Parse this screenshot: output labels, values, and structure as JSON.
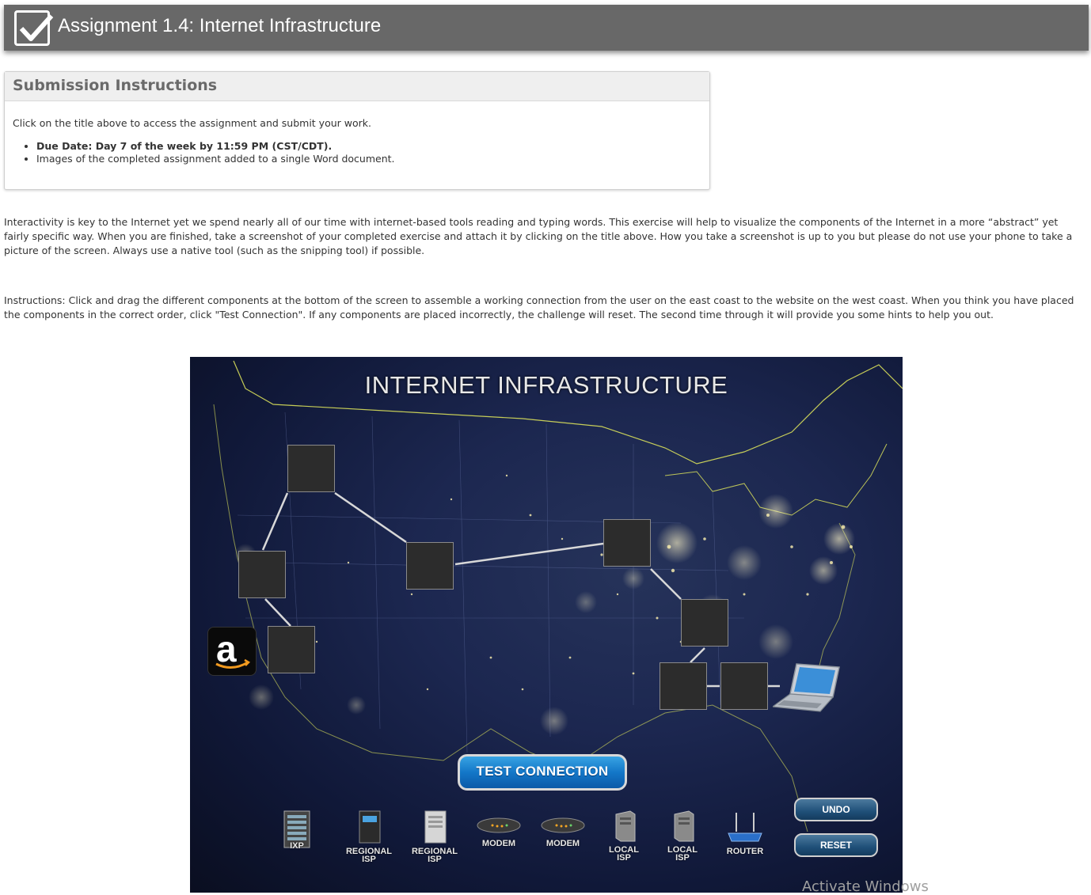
{
  "header": {
    "title": "Assignment 1.4: Internet Infrastructure"
  },
  "submission": {
    "heading": "Submission Instructions",
    "intro": "Click on the title above to access the assignment and submit your work.",
    "items": [
      "Due Date: Day 7 of the week by 11:59 PM (CST/CDT).",
      "Images of the completed assignment added to a single Word document."
    ]
  },
  "paragraphs": {
    "intro": "Interactivity is key to the Internet yet we spend nearly all of our time with internet-based tools reading and typing words. This exercise will help to visualize the components of the Internet in a more “abstract” yet fairly specific way. When you are finished, take a screenshot of your completed exercise and attach it by clicking on the title above. How you take a screenshot is up to you but please do not use your phone to take a picture of the screen. Always use a native tool (such as the snipping tool) if possible.",
    "instructions": "Instructions:  Click and drag the different components at the bottom of the screen to assemble a working connection from the user on the east coast to the website on the west coast.  When you think you have placed the components in the correct order, click \"Test Connection\".  If any components are placed incorrectly, the challenge will reset.  The second time through it will provide you some hints to help you out."
  },
  "interactive": {
    "title": "INTERNET INFRASTRUCTURE",
    "test_button": "TEST CONNECTION",
    "undo_button": "UNDO",
    "reset_button": "RESET",
    "amazon_letter": "a",
    "components": [
      {
        "l1": "",
        "l2": "IXP",
        "icon": "server-rack-icon"
      },
      {
        "l1": "REGIONAL",
        "l2": "ISP",
        "icon": "server-tower-icon"
      },
      {
        "l1": "REGIONAL",
        "l2": "ISP",
        "icon": "server-tower-icon"
      },
      {
        "l1": "",
        "l2": "MODEM",
        "icon": "modem-icon"
      },
      {
        "l1": "",
        "l2": "MODEM",
        "icon": "modem-icon"
      },
      {
        "l1": "LOCAL",
        "l2": "ISP",
        "icon": "server-box-icon"
      },
      {
        "l1": "LOCAL",
        "l2": "ISP",
        "icon": "server-box-icon"
      },
      {
        "l1": "",
        "l2": "ROUTER",
        "icon": "router-icon"
      }
    ]
  },
  "overlay": {
    "watermark": "Activate Windows"
  }
}
